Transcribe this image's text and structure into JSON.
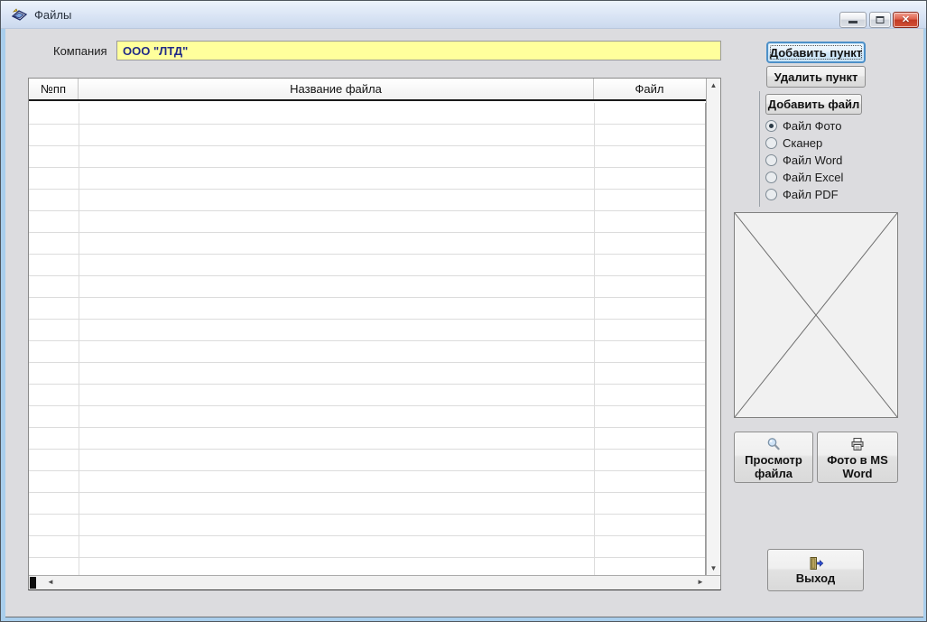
{
  "window": {
    "title": "Файлы"
  },
  "window_controls": {
    "minimize": "minimize",
    "maximize": "maximize",
    "close": "close"
  },
  "company": {
    "label": "Компания",
    "value": "ООО \"ЛТД\""
  },
  "table": {
    "columns": [
      {
        "label": "№пп"
      },
      {
        "label": "Название файла"
      },
      {
        "label": "Файл"
      }
    ],
    "rows": []
  },
  "item_buttons": {
    "add_item": "Добавить пункт",
    "delete_item": "Удалить пункт",
    "add_file": "Добавить файл"
  },
  "file_type_options": [
    {
      "label": "Файл Фото",
      "selected": true
    },
    {
      "label": "Сканер",
      "selected": false
    },
    {
      "label": "Файл Word",
      "selected": false
    },
    {
      "label": "Файл Excel",
      "selected": false
    },
    {
      "label": "Файл PDF",
      "selected": false
    }
  ],
  "preview": {
    "state": "empty-crossed-placeholder"
  },
  "action_buttons": {
    "view_file": "Просмотр файла",
    "photo_to_word": "Фото в MS Word",
    "exit": "Выход"
  },
  "icons": {
    "title": "form-icon",
    "view": "magnifier-icon",
    "word": "printer-icon",
    "exit": "exit-door-icon"
  },
  "colors": {
    "field_bg": "#FFFF9C",
    "field_text": "#202A87",
    "focus_border": "#4D90C8",
    "titlebar_top": "#EDF3FC",
    "titlebar_bottom": "#CBD9EE",
    "frame_blue": "#A9CEEC",
    "window_bg": "#DCDCDF",
    "close_red": "#C23A24"
  }
}
